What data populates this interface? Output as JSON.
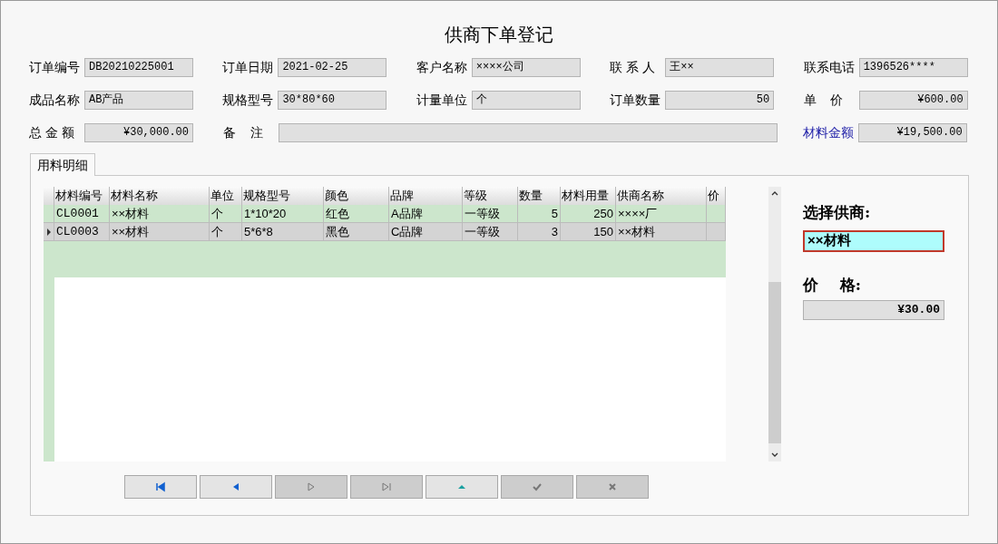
{
  "window": {
    "title": "供商下单登记"
  },
  "form": [
    [
      {
        "label": "订单编号",
        "value": "DB20210225001",
        "kind": "text"
      },
      {
        "label": "订单日期",
        "value": "2021-02-25",
        "kind": "text"
      },
      {
        "label": "客户名称",
        "value": "××××公司",
        "kind": "text"
      },
      {
        "label": "联 系 人",
        "value": "王××",
        "kind": "text"
      },
      {
        "label": "联系电话",
        "value": "1396526****",
        "kind": "text"
      }
    ],
    [
      {
        "label": "成品名称",
        "value": "AB产品",
        "kind": "text"
      },
      {
        "label": "规格型号",
        "value": "30*80*60",
        "kind": "text"
      },
      {
        "label": "计量单位",
        "value": "个",
        "kind": "text"
      },
      {
        "label": "订单数量",
        "value": "50",
        "kind": "number"
      },
      {
        "label": "单    价",
        "value": "¥600.00",
        "kind": "number"
      }
    ],
    [
      {
        "label": "总 金 额",
        "value": "¥30,000.00",
        "kind": "number"
      },
      {
        "label": "备    注",
        "kind": "wide"
      },
      {
        "label": "材料金额",
        "value": "¥19,500.00",
        "kind": "link"
      }
    ]
  ],
  "tabs": [
    {
      "label": "用料明细",
      "selected": true
    }
  ],
  "table": {
    "columns": [
      "材料编号",
      "材料名称",
      "单位",
      "规格型号",
      "颜色",
      "品牌",
      "等级",
      "数量",
      "材料用量",
      "供商名称",
      "价"
    ],
    "rows": [
      {
        "selected": false,
        "cells": [
          "CL0001",
          "××材料",
          "个",
          "1*10*20",
          "红色",
          "A品牌",
          "一等级",
          "5",
          "250",
          "××××厂",
          null
        ]
      },
      {
        "selected": true,
        "cells": [
          "CL0003",
          "××材料",
          "个",
          "5*6*8",
          "黑色",
          "C品牌",
          "一等级",
          "3",
          "150",
          "××材料",
          null
        ]
      }
    ]
  },
  "supplier": {
    "label": "选择供商:",
    "value": "××材料"
  },
  "price": {
    "label": "价    格:",
    "value": "¥30.00"
  },
  "navigator": [
    {
      "kind": "first",
      "disabled": false
    },
    {
      "kind": "prior",
      "disabled": false
    },
    {
      "kind": "next",
      "disabled": true
    },
    {
      "kind": "last",
      "disabled": true
    },
    {
      "kind": "edit",
      "disabled": false
    },
    {
      "kind": "post",
      "disabled": true
    },
    {
      "kind": "cancel",
      "disabled": true
    }
  ]
}
